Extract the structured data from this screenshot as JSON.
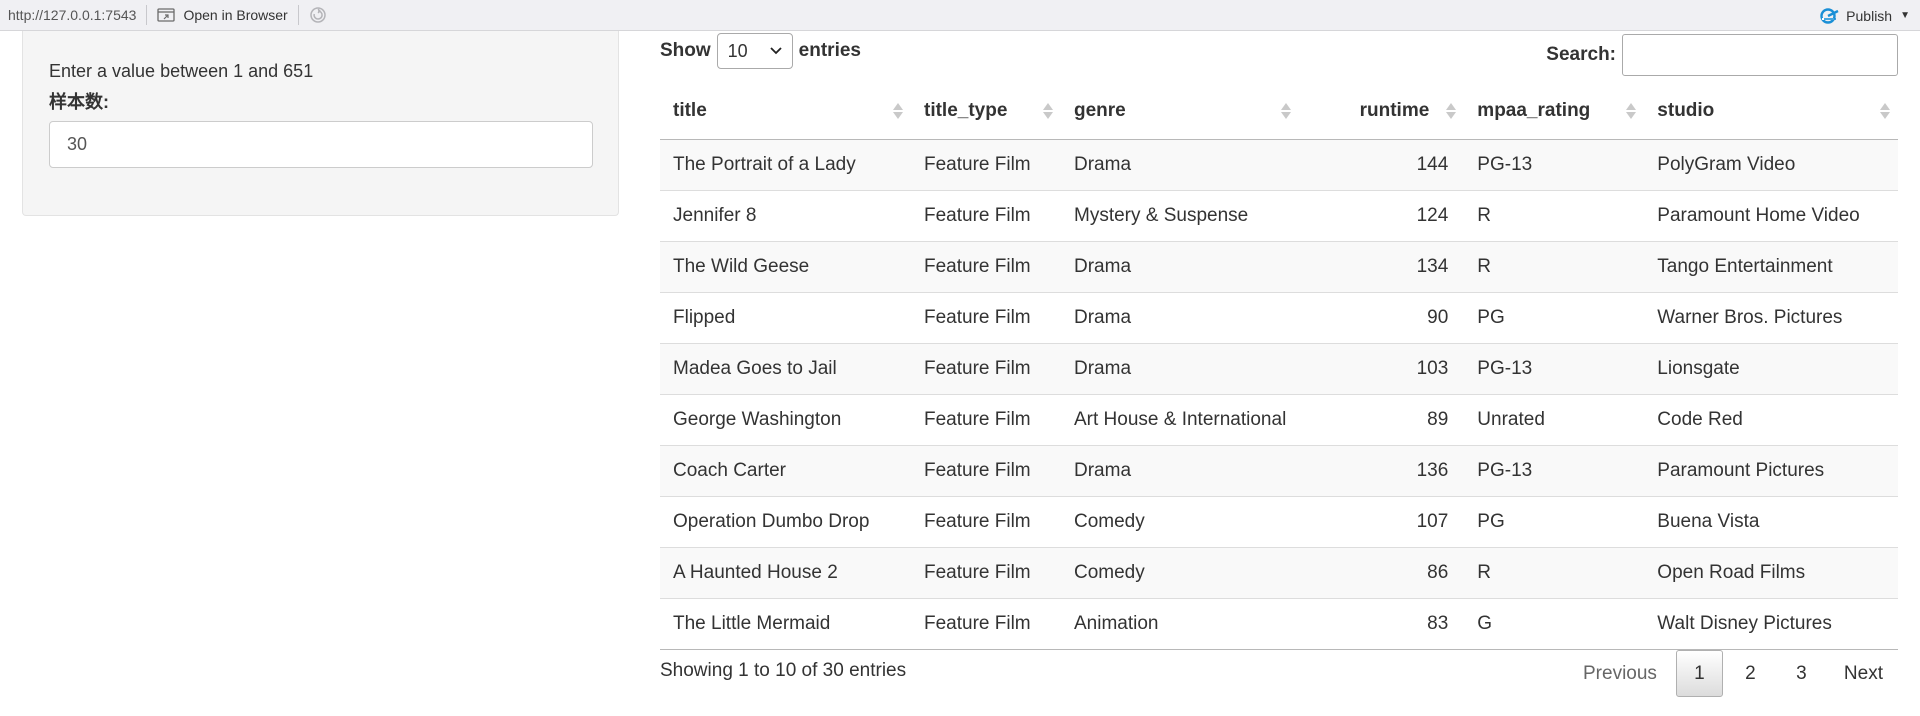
{
  "viewer": {
    "url": "http://127.0.0.1:7543",
    "open_in_browser": "Open in Browser",
    "publish": "Publish"
  },
  "sidebar": {
    "help_text": "Enter a value between 1 and 651",
    "label": "样本数:",
    "input_value": "30"
  },
  "table": {
    "length_prefix": "Show",
    "length_value": "10",
    "length_suffix": "entries",
    "search_label": "Search:",
    "search_value": "",
    "columns": [
      "title",
      "title_type",
      "genre",
      "runtime",
      "mpaa_rating",
      "studio"
    ],
    "rows": [
      [
        "The Portrait of a Lady",
        "Feature Film",
        "Drama",
        "144",
        "PG-13",
        "PolyGram Video"
      ],
      [
        "Jennifer 8",
        "Feature Film",
        "Mystery & Suspense",
        "124",
        "R",
        "Paramount Home Video"
      ],
      [
        "The Wild Geese",
        "Feature Film",
        "Drama",
        "134",
        "R",
        "Tango Entertainment"
      ],
      [
        "Flipped",
        "Feature Film",
        "Drama",
        "90",
        "PG",
        "Warner Bros. Pictures"
      ],
      [
        "Madea Goes to Jail",
        "Feature Film",
        "Drama",
        "103",
        "PG-13",
        "Lionsgate"
      ],
      [
        "George Washington",
        "Feature Film",
        "Art House & International",
        "89",
        "Unrated",
        "Code Red"
      ],
      [
        "Coach Carter",
        "Feature Film",
        "Drama",
        "136",
        "PG-13",
        "Paramount Pictures"
      ],
      [
        "Operation Dumbo Drop",
        "Feature Film",
        "Comedy",
        "107",
        "PG",
        "Buena Vista"
      ],
      [
        "A Haunted House 2",
        "Feature Film",
        "Comedy",
        "86",
        "R",
        "Open Road Films"
      ],
      [
        "The Little Mermaid",
        "Feature Film",
        "Animation",
        "83",
        "G",
        "Walt Disney Pictures"
      ]
    ],
    "info": "Showing 1 to 10 of 30 entries",
    "pagination": {
      "previous": "Previous",
      "pages": [
        "1",
        "2",
        "3"
      ],
      "current": "1",
      "next": "Next"
    }
  }
}
